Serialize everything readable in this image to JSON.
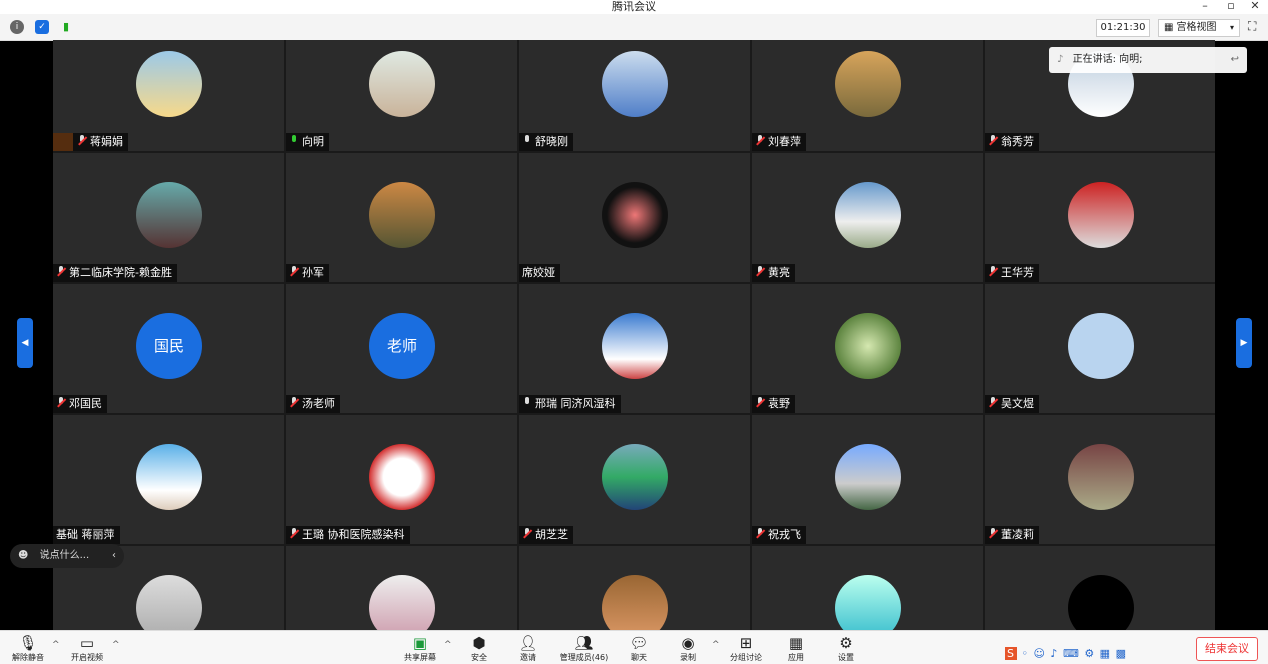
{
  "window": {
    "title": "腾讯会议"
  },
  "topbar": {
    "timer": "01:21:30",
    "view_label": "宫格视图"
  },
  "speaking": {
    "text": "正在讲话: 向明;"
  },
  "chat": {
    "placeholder": "说点什么..."
  },
  "participants": [
    {
      "name": "蒋娟娟",
      "mic": "off",
      "host": true
    },
    {
      "name": "向明",
      "mic": "on"
    },
    {
      "name": "舒晓刚",
      "mic": "neutral"
    },
    {
      "name": "刘春萍",
      "mic": "off"
    },
    {
      "name": "翁秀芳",
      "mic": "off"
    },
    {
      "name": "第二临床学院-赖金胜",
      "mic": "off"
    },
    {
      "name": "孙军",
      "mic": "off"
    },
    {
      "name": "席姣娅",
      "mic": "none"
    },
    {
      "name": "黄亮",
      "mic": "off"
    },
    {
      "name": "王华芳",
      "mic": "off"
    },
    {
      "name": "邓国民",
      "mic": "off",
      "avatar_text": "国民"
    },
    {
      "name": "汤老师",
      "mic": "off",
      "avatar_text": "老师"
    },
    {
      "name": "邢瑞 同济风湿科",
      "mic": "neutral"
    },
    {
      "name": "袁野",
      "mic": "off"
    },
    {
      "name": "吴文煜",
      "mic": "off"
    },
    {
      "name": "基础 蒋丽萍",
      "mic": "none"
    },
    {
      "name": "王璐 协和医院感染科",
      "mic": "off"
    },
    {
      "name": "胡芝芝",
      "mic": "off"
    },
    {
      "name": "祝戎飞",
      "mic": "off"
    },
    {
      "name": "董凌莉",
      "mic": "off"
    },
    {
      "name": "",
      "mic": "none"
    },
    {
      "name": "",
      "mic": "none"
    },
    {
      "name": "",
      "mic": "none"
    },
    {
      "name": "",
      "mic": "none"
    },
    {
      "name": "",
      "mic": "none"
    }
  ],
  "toolbar": {
    "unmute": "解除静音",
    "start_video": "开启视频",
    "share": "共享屏幕",
    "security": "安全",
    "invite": "邀请",
    "members": "管理成员(46)",
    "chat": "聊天",
    "record": "录制",
    "breakout": "分组讨论",
    "apps": "应用",
    "settings": "设置",
    "end": "结束会议"
  },
  "colors": {
    "accent": "#1a6ee0",
    "end": "#e33333",
    "tile_bg": "#2b2b2b"
  }
}
